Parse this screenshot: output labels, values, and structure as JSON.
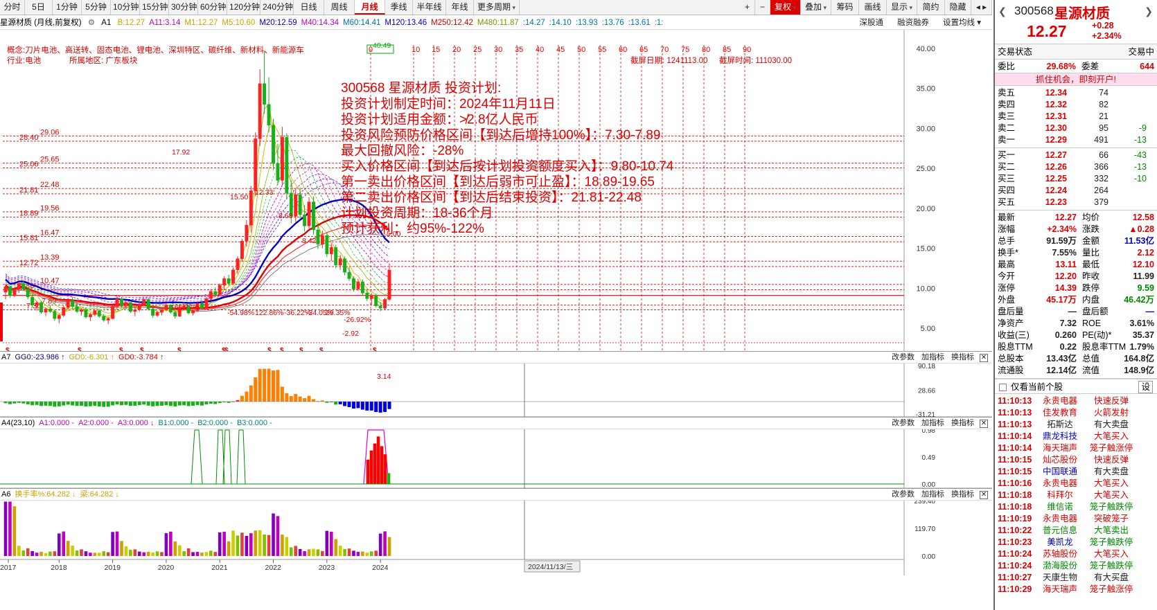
{
  "periods": [
    "分时",
    "5日",
    "1分钟",
    "5分钟",
    "10分钟",
    "15分钟",
    "30分钟",
    "60分钟",
    "120分钟",
    "240分钟",
    "日线",
    "周线",
    "月线",
    "季线",
    "半年线",
    "年线",
    "更多周期"
  ],
  "active_period": "月线",
  "toolbar_right": {
    "plus": "+",
    "minus": "−",
    "fq": "复权",
    "overlay": "叠加",
    "chips": "筹码",
    "draw": "画线",
    "display": "显示",
    "brief": "简约",
    "hide": "隐藏",
    "arrows": "◂ ▸"
  },
  "main_header": {
    "title": "星源材质 (月线,前复权)",
    "indicator": "A1",
    "values": [
      {
        "t": "B:12.27",
        "c": "#c9a400"
      },
      {
        "t": "A11:3.14",
        "c": "#c000c0"
      },
      {
        "t": "M1:12.27",
        "c": "#c9a400"
      },
      {
        "t": "M5:10.60",
        "c": "#c9a400"
      },
      {
        "t": "M20:12.59",
        "c": "#0000c0"
      },
      {
        "t": "M40:14.34",
        "c": "#c000c0"
      },
      {
        "t": "M60:14.41",
        "c": "#0070a0"
      },
      {
        "t": "M120:13.46",
        "c": "#0000c0"
      },
      {
        "t": "M250:12.42",
        "c": "#d00000"
      },
      {
        "t": "M480:11.87",
        "c": "#809000"
      },
      {
        "t": ":14.27",
        "c": "#0070c0"
      },
      {
        "t": ":14.10",
        "c": "#0070c0"
      },
      {
        "t": ":13.93",
        "c": "#0070c0"
      },
      {
        "t": ":13.76",
        "c": "#0070c0"
      },
      {
        "t": ":13.61",
        "c": "#0070c0"
      },
      {
        "t": ":1:",
        "c": "#0070c0"
      }
    ],
    "right_links": [
      "深股通",
      "融资融券",
      "设置均线"
    ]
  },
  "info_lines": {
    "concept": "概念:刀片电池、高送转、固态电池、锂电池、深圳特区、碳纤维、新材料、新能源车",
    "industry": "行业:电池",
    "region": "所属地区: 广东板块",
    "screenshot_date": "截屏日期: 1241113.00",
    "screenshot_time": "截屏时间: 111030.00"
  },
  "plan": {
    "title": "300568 星源材质 投资计划:",
    "lines": [
      "投资计划制定时间：2024年11月11日",
      "投资计划适用金额：≯2.8亿人民币",
      "投资风险预防价格区间【到达后增持100%】：7.30-7.89",
      "最大回撤风险：-28%",
      "买入价格区间【到达后按计划投资额度买入】：9.80-10.74",
      "第一卖出价格区间【到达后弱市可止盈】：18.89-19.65",
      "第二卖出价格区间【到达后结束投资】：21.81-22.48",
      "计划投资周期：18-36个月",
      "预计获利：约95%-122%"
    ]
  },
  "timer_numbers": [
    "0",
    "10",
    "15",
    "20",
    "25",
    "30",
    "35",
    "40",
    "45",
    "50",
    "55",
    "60",
    "65",
    "70",
    "75",
    "80",
    "85",
    "90"
  ],
  "price_axis": [
    "40.00",
    "35.00",
    "30.00",
    "25.00",
    "20.00",
    "15.00",
    "10.00",
    "5.00"
  ],
  "level_labels": [
    {
      "l": "28.40",
      "r": "29.06"
    },
    {
      "l": "25.06",
      "r": "25.65"
    },
    {
      "l": "21.81",
      "r": "22.48"
    },
    {
      "l": "18.89",
      "r": "19.56"
    },
    {
      "l": "15.81",
      "r": "16.47"
    },
    {
      "l": "12.72",
      "r": "13.39"
    },
    {
      "l": "9.80",
      "r": "10.47"
    },
    {
      "l": "7.30",
      "r": "7.89"
    }
  ],
  "chart_annotations": [
    "17.92",
    "15.50",
    "165.77%",
    "-54.98%",
    "122.86%",
    "-36.22%",
    "-34.05%",
    "29.35%",
    "-26.92%",
    "-2.92",
    "3.14",
    "12.33",
    "8.68",
    "8.42",
    "5.00",
    "40.49"
  ],
  "x_axis": [
    "2017",
    "2018",
    "2019",
    "2020",
    "2021",
    "2022",
    "2023",
    "2024"
  ],
  "x_axis_cursor": "2024/11/13/三",
  "panel_a7": {
    "name": "A7",
    "vals": [
      {
        "t": "GG0:-23.986 ↑",
        "c": "#000080"
      },
      {
        "t": "GD0:-6.301 ↑",
        "c": "#c9a400"
      },
      {
        "t": "GD0:-3.784 ↑",
        "c": "#d00000"
      }
    ],
    "axis": [
      "90.18",
      "28.66",
      "-31.21"
    ]
  },
  "panel_a4": {
    "name": "A4(23,10)",
    "vals": [
      {
        "t": "A1:0.000 -",
        "c": "#c000c0"
      },
      {
        "t": "A2:0.000 -",
        "c": "#c000c0"
      },
      {
        "t": "A3:0.000 ↓",
        "c": "#c000c0"
      },
      {
        "t": "B1:0.000 -",
        "c": "#008080"
      },
      {
        "t": "B2:0.000 -",
        "c": "#008080"
      },
      {
        "t": "B3:0.000 -",
        "c": "#008080"
      }
    ],
    "axis": [
      "0.98",
      "0.49",
      "0.00"
    ]
  },
  "panel_a6": {
    "name": "A6",
    "vals": [
      {
        "t": "换手率%:64.282 ↓",
        "c": "#c9a400"
      },
      {
        "t": "梁:64.282 ↓",
        "c": "#c9a400"
      }
    ],
    "axis": [
      "239.40",
      "119.70",
      "0.00"
    ]
  },
  "panel_btns": [
    "改参数",
    "加指标",
    "换指标"
  ],
  "side": {
    "code": "300568",
    "name": "星源材质",
    "price": "12.27",
    "change": "+0.28",
    "pct": "+2.34%",
    "trade_state_label": "交易状态",
    "trade_state": "交易中",
    "wb_label": "委比",
    "wb": "29.68%",
    "wc_label": "委差",
    "wc": "644",
    "ad": "抓住机会，即刻开户!",
    "sells": [
      {
        "l": "卖五",
        "p": "12.34",
        "v": "74",
        "d": ""
      },
      {
        "l": "卖四",
        "p": "12.32",
        "v": "82",
        "d": ""
      },
      {
        "l": "卖三",
        "p": "12.31",
        "v": "21",
        "d": ""
      },
      {
        "l": "卖二",
        "p": "12.30",
        "v": "95",
        "d": "-9"
      },
      {
        "l": "卖一",
        "p": "12.29",
        "v": "491",
        "d": "-13"
      }
    ],
    "buys": [
      {
        "l": "买一",
        "p": "12.27",
        "v": "66",
        "d": "-43"
      },
      {
        "l": "买二",
        "p": "12.26",
        "v": "366",
        "d": "-13"
      },
      {
        "l": "买三",
        "p": "12.25",
        "v": "332",
        "d": "-10"
      },
      {
        "l": "买四",
        "p": "12.24",
        "v": "264",
        "d": ""
      },
      {
        "l": "买五",
        "p": "12.23",
        "v": "379",
        "d": ""
      }
    ],
    "stats": [
      {
        "l": "最新",
        "v": "12.27",
        "vc": "red",
        "l2": "均价",
        "v2": "12.58",
        "v2c": "red"
      },
      {
        "l": "涨幅",
        "v": "+2.34%",
        "vc": "red",
        "l2": "涨跌",
        "v2": "▲0.28",
        "v2c": "red"
      },
      {
        "l": "总手",
        "v": "91.59万",
        "vc": "dk",
        "l2": "金额",
        "v2": "11.53亿",
        "v2c": "blue"
      },
      {
        "l": "换手*",
        "v": "7.55%",
        "vc": "dk",
        "l2": "量比",
        "v2": "2.12",
        "v2c": "red"
      },
      {
        "l": "最高",
        "v": "13.11",
        "vc": "red",
        "l2": "最低",
        "v2": "12.10",
        "v2c": "red"
      },
      {
        "l": "今开",
        "v": "12.20",
        "vc": "red",
        "l2": "昨收",
        "v2": "11.99",
        "v2c": "dk"
      },
      {
        "l": "涨停",
        "v": "14.39",
        "vc": "red",
        "l2": "跌停",
        "v2": "9.59",
        "v2c": "green"
      },
      {
        "l": "外盘",
        "v": "45.17万",
        "vc": "red",
        "l2": "内盘",
        "v2": "46.42万",
        "v2c": "green"
      },
      {
        "l": "盘后量",
        "v": "—",
        "vc": "dk",
        "l2": "盘后额",
        "v2": "—",
        "v2c": "blue"
      },
      {
        "l": "净资产",
        "v": "7.32",
        "vc": "dk",
        "l2": "ROE",
        "v2": "3.61%",
        "v2c": "dk"
      },
      {
        "l": "收益(三)",
        "v": "0.260",
        "vc": "dk",
        "l2": "PE(动)*",
        "v2": "35.37",
        "v2c": "dk"
      },
      {
        "l": "股息TTM",
        "v": "0.22",
        "vc": "dk",
        "l2": "股息率TTM",
        "v2": "1.79%",
        "v2c": "dk"
      },
      {
        "l": "总股本",
        "v": "13.43亿",
        "vc": "dk",
        "l2": "总值",
        "v2": "164.8亿",
        "v2c": "dk"
      },
      {
        "l": "流通股",
        "v": "12.14亿",
        "vc": "dk",
        "l2": "流值",
        "v2": "148.9亿",
        "v2c": "dk"
      }
    ],
    "only_current": "仅看当前个股",
    "settings": "设",
    "ticks": [
      {
        "t": "11:10:13",
        "n": "永贵电器",
        "nc": "red",
        "e": "快速反弹",
        "ec": "red"
      },
      {
        "t": "11:10:13",
        "n": "佳发教育",
        "nc": "red",
        "e": "火箭发射",
        "ec": "red"
      },
      {
        "t": "11:10:13",
        "n": "拓斯达",
        "nc": "dk",
        "e": "有大卖盘",
        "ec": "dk"
      },
      {
        "t": "11:10:14",
        "n": "鼎龙科技",
        "nc": "blue",
        "e": "大笔买入",
        "ec": "red"
      },
      {
        "t": "11:10:14",
        "n": "海天瑞声",
        "nc": "red",
        "e": "笼子触涨停",
        "ec": "red"
      },
      {
        "t": "11:10:15",
        "n": "灿芯股份",
        "nc": "red",
        "e": "快速反弹",
        "ec": "red"
      },
      {
        "t": "11:10:15",
        "n": "中国联通",
        "nc": "blue",
        "e": "有大卖盘",
        "ec": "dk"
      },
      {
        "t": "11:10:16",
        "n": "永贵电器",
        "nc": "red",
        "e": "大笔买入",
        "ec": "red"
      },
      {
        "t": "11:10:18",
        "n": "科拜尔",
        "nc": "red",
        "e": "大笔买入",
        "ec": "red"
      },
      {
        "t": "11:10:18",
        "n": "维信诺",
        "nc": "green",
        "e": "笼子触跌停",
        "ec": "green"
      },
      {
        "t": "11:10:19",
        "n": "永贵电器",
        "nc": "red",
        "e": "突破笼子",
        "ec": "red"
      },
      {
        "t": "11:10:22",
        "n": "普元信息",
        "nc": "green",
        "e": "大笔卖出",
        "ec": "green"
      },
      {
        "t": "11:10:23",
        "n": "美凯龙",
        "nc": "blue",
        "e": "笼子触跌停",
        "ec": "green"
      },
      {
        "t": "11:10:24",
        "n": "苏轴股份",
        "nc": "red",
        "e": "大笔买入",
        "ec": "red"
      },
      {
        "t": "11:10:24",
        "n": "渤海股份",
        "nc": "green",
        "e": "笼子触跌停",
        "ec": "green"
      },
      {
        "t": "11:10:27",
        "n": "天康生物",
        "nc": "dk",
        "e": "有大买盘",
        "ec": "dk"
      },
      {
        "t": "11:10:29",
        "n": "海天瑞声",
        "nc": "red",
        "e": "笼子触涨停",
        "ec": "red"
      }
    ]
  },
  "chart_data": {
    "type": "candlestick",
    "period": "monthly",
    "x_range": [
      "2017",
      "2024"
    ],
    "ylim": [
      0,
      40
    ],
    "y_ticks": [
      40,
      35,
      30,
      25,
      20,
      15,
      10,
      5
    ],
    "candles": [
      [
        9.5,
        10.5,
        8.6,
        10.2
      ],
      [
        10.2,
        10.3,
        8.8,
        9.1
      ],
      [
        9.1,
        10.1,
        8.9,
        9.9
      ],
      [
        9.9,
        10.8,
        9.4,
        10.6
      ],
      [
        10.6,
        11.0,
        9.7,
        9.9
      ],
      [
        9.9,
        10.0,
        8.6,
        8.9
      ],
      [
        8.9,
        9.3,
        7.6,
        7.9
      ],
      [
        7.9,
        8.4,
        7.2,
        8.2
      ],
      [
        8.2,
        8.4,
        6.8,
        7.0
      ],
      [
        7.0,
        7.6,
        6.5,
        7.4
      ],
      [
        7.4,
        7.9,
        6.9,
        7.1
      ],
      [
        7.1,
        7.3,
        5.9,
        6.2
      ],
      [
        6.2,
        6.8,
        5.6,
        6.6
      ],
      [
        6.6,
        7.8,
        6.4,
        7.6
      ],
      [
        7.6,
        8.8,
        7.3,
        8.5
      ],
      [
        8.5,
        8.9,
        7.4,
        7.7
      ],
      [
        7.7,
        8.0,
        6.9,
        7.1
      ],
      [
        7.1,
        7.5,
        6.6,
        7.3
      ],
      [
        7.3,
        7.6,
        6.2,
        6.4
      ],
      [
        6.4,
        6.9,
        5.9,
        6.7
      ],
      [
        6.7,
        7.4,
        6.5,
        7.2
      ],
      [
        7.2,
        7.3,
        6.3,
        6.5
      ],
      [
        6.5,
        6.8,
        5.8,
        6.0
      ],
      [
        6.0,
        6.4,
        5.5,
        6.2
      ],
      [
        6.2,
        7.9,
        6.1,
        7.7
      ],
      [
        7.7,
        9.0,
        7.5,
        8.7
      ],
      [
        8.7,
        8.9,
        7.6,
        7.9
      ],
      [
        7.9,
        8.5,
        7.4,
        8.2
      ],
      [
        8.2,
        8.4,
        6.9,
        7.1
      ],
      [
        7.1,
        7.6,
        6.5,
        7.3
      ],
      [
        7.3,
        8.4,
        7.1,
        8.0
      ],
      [
        8.0,
        8.7,
        7.8,
        8.6
      ],
      [
        8.6,
        8.8,
        7.2,
        7.4
      ],
      [
        7.4,
        7.7,
        6.3,
        6.6
      ],
      [
        6.6,
        7.2,
        6.4,
        7.0
      ],
      [
        7.0,
        7.5,
        6.6,
        7.3
      ],
      [
        7.3,
        8.1,
        7.1,
        7.9
      ],
      [
        7.9,
        8.0,
        6.8,
        7.0
      ],
      [
        7.0,
        7.4,
        6.2,
        6.5
      ],
      [
        6.5,
        7.9,
        6.4,
        7.6
      ],
      [
        7.6,
        8.3,
        7.2,
        7.8
      ],
      [
        7.8,
        7.9,
        6.7,
        6.9
      ],
      [
        6.9,
        7.4,
        6.6,
        7.2
      ],
      [
        7.2,
        8.3,
        7.0,
        8.1
      ],
      [
        8.1,
        8.5,
        7.3,
        7.5
      ],
      [
        7.5,
        8.9,
        7.4,
        8.7
      ],
      [
        8.7,
        9.9,
        8.4,
        9.6
      ],
      [
        9.6,
        10.1,
        8.9,
        9.2
      ],
      [
        9.2,
        10.6,
        9.0,
        10.4
      ],
      [
        10.4,
        11.5,
        9.8,
        11.2
      ],
      [
        11.2,
        11.7,
        10.3,
        10.6
      ],
      [
        10.6,
        12.6,
        10.4,
        12.3
      ],
      [
        12.3,
        14.0,
        11.8,
        13.7
      ],
      [
        13.7,
        16.2,
        13.3,
        15.9
      ],
      [
        15.9,
        18.5,
        15.2,
        17.9
      ],
      [
        17.9,
        22.8,
        17.0,
        22.2
      ],
      [
        22.2,
        29.5,
        21.5,
        28.7
      ],
      [
        28.7,
        37.4,
        27.8,
        35.6
      ],
      [
        35.6,
        39.7,
        31.8,
        33.0
      ],
      [
        33.0,
        36.4,
        29.5,
        30.4
      ],
      [
        30.4,
        31.2,
        24.8,
        25.6
      ],
      [
        25.6,
        28.1,
        22.9,
        23.5
      ],
      [
        23.5,
        30.2,
        22.8,
        28.9
      ],
      [
        28.9,
        29.4,
        21.1,
        21.9
      ],
      [
        21.9,
        23.5,
        18.1,
        19.0
      ],
      [
        19.0,
        22.4,
        18.3,
        21.7
      ],
      [
        21.7,
        22.6,
        18.6,
        19.2
      ],
      [
        19.2,
        20.4,
        17.1,
        17.8
      ],
      [
        17.8,
        21.4,
        17.3,
        20.8
      ],
      [
        20.8,
        21.5,
        16.7,
        17.3
      ],
      [
        17.3,
        18.1,
        14.9,
        15.5
      ],
      [
        15.5,
        17.2,
        15.0,
        16.6
      ],
      [
        16.6,
        16.9,
        13.9,
        14.3
      ],
      [
        14.3,
        15.6,
        13.4,
        15.1
      ],
      [
        15.1,
        15.4,
        12.5,
        12.9
      ],
      [
        12.9,
        14.2,
        12.3,
        13.7
      ],
      [
        13.7,
        14.0,
        11.6,
        12.0
      ],
      [
        12.0,
        12.7,
        10.9,
        11.2
      ],
      [
        11.2,
        11.5,
        9.6,
        9.9
      ],
      [
        9.9,
        11.2,
        9.7,
        10.8
      ],
      [
        10.8,
        11.1,
        9.1,
        9.4
      ],
      [
        9.4,
        9.9,
        8.4,
        8.7
      ],
      [
        8.7,
        9.4,
        7.9,
        9.1
      ],
      [
        9.1,
        9.3,
        7.6,
        7.8
      ],
      [
        7.8,
        8.3,
        7.1,
        7.5
      ],
      [
        7.5,
        8.8,
        7.3,
        8.6
      ],
      [
        8.6,
        13.1,
        8.4,
        12.27
      ]
    ],
    "levels": [
      29.06,
      28.4,
      25.65,
      25.06,
      22.48,
      21.81,
      19.56,
      18.89,
      16.47,
      15.81,
      13.39,
      12.72,
      10.47,
      9.8,
      7.89,
      7.3
    ],
    "last_close": 12.27,
    "sub_a7": {
      "ylim": [
        -31.21,
        90.18
      ]
    },
    "sub_a4": {
      "ylim": [
        0,
        0.98
      ]
    },
    "sub_a6": {
      "ylim": [
        0,
        239.4
      ]
    }
  }
}
